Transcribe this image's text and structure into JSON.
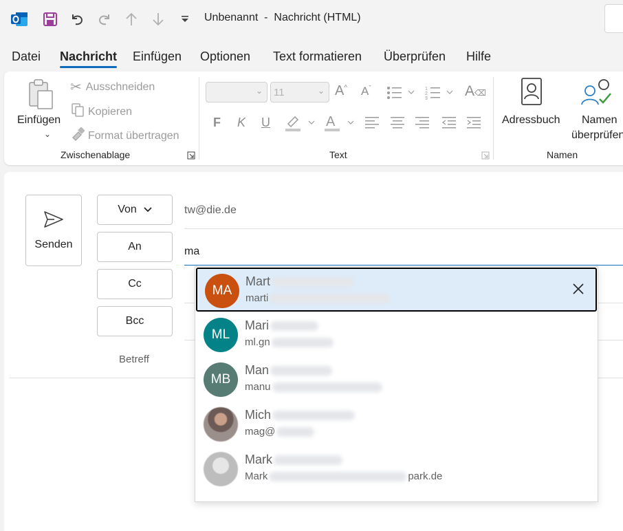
{
  "window": {
    "title": "Unbenannt  -  Nachricht (HTML)"
  },
  "menu": {
    "tabs": [
      {
        "label": "Datei"
      },
      {
        "label": "Nachricht",
        "active": true
      },
      {
        "label": "Einfügen"
      },
      {
        "label": "Optionen"
      },
      {
        "label": "Text formatieren"
      },
      {
        "label": "Überprüfen"
      },
      {
        "label": "Hilfe"
      }
    ]
  },
  "ribbon": {
    "clipboard": {
      "paste_label": "Einfügen",
      "cut_label": "Ausschneiden",
      "copy_label": "Kopieren",
      "format_painter_label": "Format übertragen",
      "group_label": "Zwischenablage"
    },
    "text": {
      "font_name_value": "",
      "font_size_value": "11",
      "bold_glyph": "F",
      "italic_glyph": "K",
      "underline_glyph": "U",
      "group_label": "Text"
    },
    "names": {
      "address_book_label": "Adressbuch",
      "check_names_label_1": "Namen",
      "check_names_label_2": "überprüfen",
      "group_label": "Namen"
    }
  },
  "compose": {
    "send_label": "Senden",
    "from_label": "Von",
    "from_value": "tw@die.de",
    "to_label": "An",
    "to_value": "ma",
    "cc_label": "Cc",
    "bcc_label": "Bcc",
    "subject_label": "Betreff"
  },
  "suggestions": [
    {
      "initials": "MA",
      "name_visible": "Mart",
      "email_visible": "marti",
      "email_suffix": "",
      "avatar_color": "#ca5010",
      "photo": false,
      "selected": true
    },
    {
      "initials": "ML",
      "name_visible": "Mari",
      "email_visible": "ml.gn",
      "email_suffix": "",
      "avatar_color": "#038387",
      "photo": false,
      "selected": false
    },
    {
      "initials": "MB",
      "name_visible": "Man",
      "email_visible": "manu",
      "email_suffix": "",
      "avatar_color": "#567c73",
      "photo": false,
      "selected": false
    },
    {
      "initials": "",
      "name_visible": "Mich",
      "email_visible": "mag@",
      "email_suffix": "",
      "avatar_color": "#8a7d78",
      "photo": true,
      "selected": false
    },
    {
      "initials": "",
      "name_visible": "Mark",
      "email_visible": "Mark",
      "email_suffix": "park.de",
      "avatar_color": "#c4c4c4",
      "photo": true,
      "selected": false
    }
  ],
  "colors": {
    "accent": "#0f6cbd",
    "outlook_blue": "#0a5eb0",
    "save_purple": "#9c3d9a",
    "selected_row_bg": "#deecf9"
  },
  "icons": [
    "outlook-logo-icon",
    "save-icon",
    "undo-icon",
    "redo-icon",
    "arrow-up-icon",
    "arrow-down-icon",
    "customize-qat-icon",
    "paste-icon",
    "cut-icon",
    "copy-icon",
    "format-painter-icon",
    "grow-font-icon",
    "shrink-font-icon",
    "bullets-icon",
    "numbering-icon",
    "clear-formatting-icon",
    "highlight-icon",
    "font-color-icon",
    "align-left-icon",
    "align-center-icon",
    "align-right-icon",
    "decrease-indent-icon",
    "increase-indent-icon",
    "address-book-icon",
    "check-names-icon",
    "send-icon",
    "chevron-down-icon",
    "close-icon",
    "dialog-launcher-icon"
  ]
}
